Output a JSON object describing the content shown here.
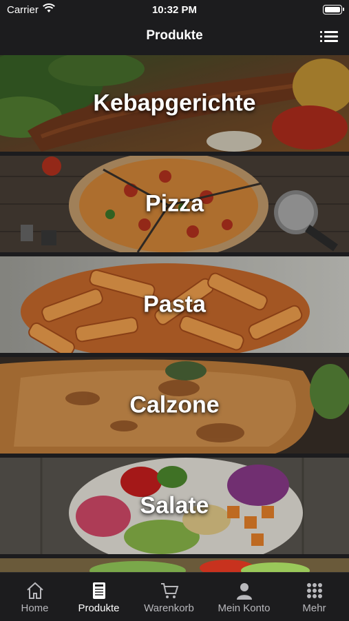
{
  "status_bar": {
    "carrier": "Carrier",
    "time": "10:32 PM"
  },
  "header": {
    "title": "Produkte",
    "menu_icon": "list-icon"
  },
  "categories": [
    {
      "label": "Kebapgerichte"
    },
    {
      "label": "Pizza"
    },
    {
      "label": "Pasta"
    },
    {
      "label": "Calzone"
    },
    {
      "label": "Salate"
    }
  ],
  "tab_bar": {
    "items": [
      {
        "label": "Home",
        "icon": "home-icon"
      },
      {
        "label": "Produkte",
        "icon": "menu-card-icon",
        "active": true
      },
      {
        "label": "Warenkorb",
        "icon": "cart-icon"
      },
      {
        "label": "Mein Konto",
        "icon": "person-icon"
      },
      {
        "label": "Mehr",
        "icon": "grid-icon"
      }
    ]
  },
  "colors": {
    "background": "#1c1c1e",
    "active_tab": "#ffffff",
    "inactive_tab": "#b8b8bc"
  }
}
